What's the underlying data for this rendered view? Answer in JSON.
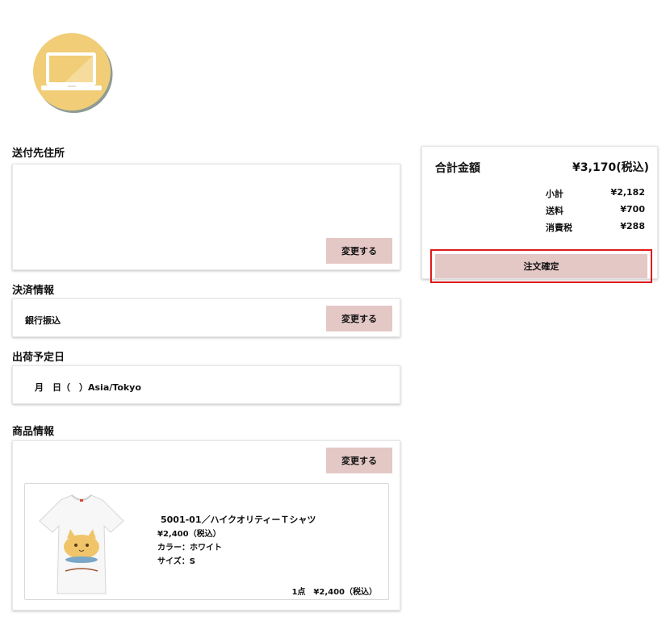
{
  "colors": {
    "accent_button": "#e4c8c6",
    "highlight_border": "#e01b1b",
    "logo_circle": "#f0cd76"
  },
  "icons": {
    "logo": "laptop-icon"
  },
  "shipping": {
    "title": "送付先住所",
    "change_label": "変更する"
  },
  "payment": {
    "title": "決済情報",
    "method": "銀行振込",
    "change_label": "変更する"
  },
  "ship_date": {
    "title": "出荷予定日",
    "value": "月　日（　）Asia/Tokyo"
  },
  "products": {
    "title": "商品情報",
    "change_label": "変更する",
    "items": [
      {
        "name": "5001-01／ハイクオリティーＴシャツ",
        "price": "¥2,400（税込）",
        "color": "カラー：ホワイト",
        "size": "サイズ：S",
        "qty_total": "1点　¥2,400（税込）"
      }
    ]
  },
  "summary": {
    "total_label": "合計金額",
    "total_value": "¥3,170(税込)",
    "rows": [
      {
        "label": "小計",
        "value": "¥2,182"
      },
      {
        "label": "送料",
        "value": "¥700"
      },
      {
        "label": "消費税",
        "value": "¥288"
      }
    ],
    "confirm_label": "注文確定"
  }
}
